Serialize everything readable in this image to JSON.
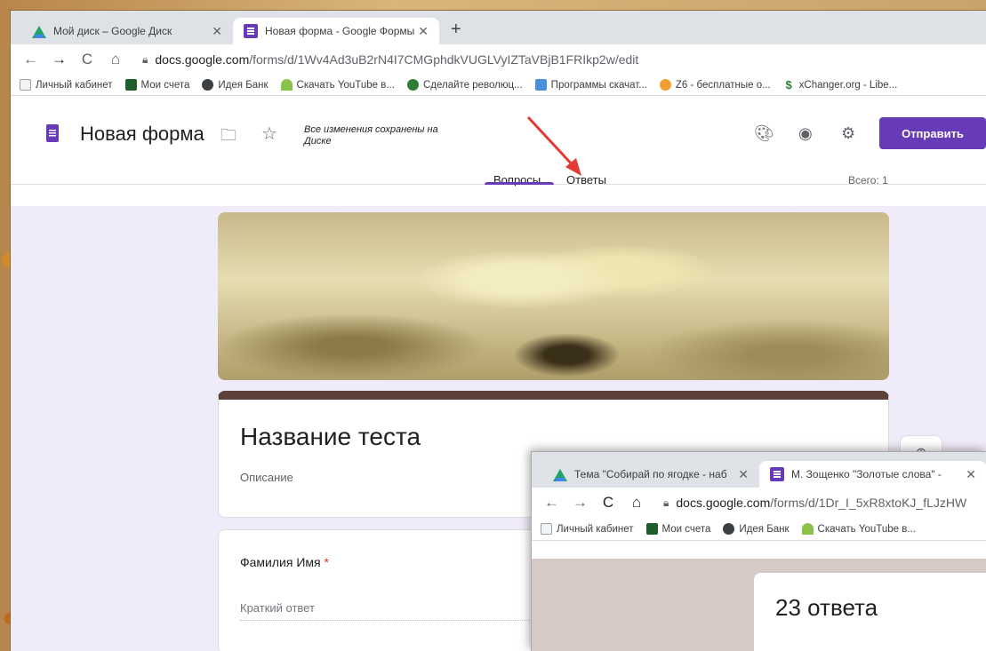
{
  "browser": {
    "tabs": [
      {
        "label": "Мой диск – Google Диск",
        "icon": "google-drive-icon",
        "active": false
      },
      {
        "label": "Новая форма - Google Формы",
        "icon": "google-forms-icon",
        "active": true
      }
    ],
    "url": {
      "host": "docs.google.com",
      "path": "/forms/d/1Wv4Ad3uB2rN4I7CMGphdkVUGLVyIZTaVBjB1FRIkp2w/edit"
    },
    "bookmarks": [
      "Личный кабинет",
      "Мои счета",
      "Идея Банк",
      "Скачать YouTube в...",
      "Сделайте революц...",
      "Программы скачат...",
      "Z6 - бесплатные о...",
      "xChanger.org - Libe..."
    ]
  },
  "form_header": {
    "title": "Новая форма",
    "saved_status": "Все изменения сохранены на Диске",
    "send_label": "Отправить",
    "tab_questions": "Вопросы",
    "tab_responses": "Ответы",
    "total": "Всего: 1"
  },
  "form": {
    "title": "Название теста",
    "description": "Описание",
    "question": {
      "label": "Фамилия Имя",
      "required_mark": "*",
      "placeholder": "Краткий ответ"
    }
  },
  "overlay": {
    "tabs": [
      {
        "label": "Тема \"Собирай по ягодке - наб",
        "icon": "google-drive-icon"
      },
      {
        "label": "М. Зощенко \"Золотые слова\" -",
        "icon": "google-forms-icon"
      }
    ],
    "url": {
      "host": "docs.google.com",
      "path": "/forms/d/1Dr_I_5xR8xtoKJ_fLJzHW"
    },
    "bookmarks": [
      "Личный кабинет",
      "Мои счета",
      "Идея Банк",
      "Скачать YouTube в..."
    ],
    "responses_count": "23 ответа"
  },
  "colors": {
    "accent": "#673ab7",
    "header_stripe": "#5d4037",
    "arrow": "#e53935"
  }
}
